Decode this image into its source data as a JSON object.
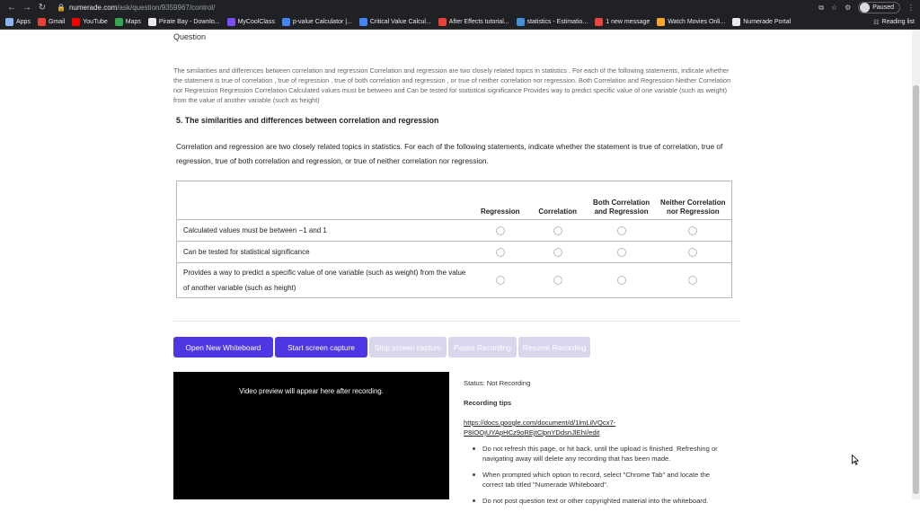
{
  "browser": {
    "url_host": "numerade.com",
    "url_path": "/ask/question/9359967/control/",
    "profile_label": "Paused",
    "bookmarks": [
      {
        "label": "Apps",
        "color": "#8ab4f8"
      },
      {
        "label": "Gmail",
        "color": "#ea4335"
      },
      {
        "label": "YouTube",
        "color": "#ff0000"
      },
      {
        "label": "Maps",
        "color": "#34a853"
      },
      {
        "label": "Pirate Bay - Downlo...",
        "color": "#e8eaed"
      },
      {
        "label": "MyCoolClass",
        "color": "#7c4dff"
      },
      {
        "label": "p-value Calculator |...",
        "color": "#4285f4"
      },
      {
        "label": "Critical Value Calcul...",
        "color": "#4285f4"
      },
      {
        "label": "After Effects tutorial...",
        "color": "#ea4335"
      },
      {
        "label": "statistics - Estimatio...",
        "color": "#4a90d9"
      },
      {
        "label": "1 new message",
        "color": "#e8453c"
      },
      {
        "label": "Watch Movies Onli...",
        "color": "#f9a825"
      },
      {
        "label": "Numerade Portal",
        "color": "#e8eaed"
      }
    ],
    "reading_list": "Reading list"
  },
  "question": {
    "label": "Question",
    "text": "The similarities and differences between correlation and regression Correlation and regression are two closely related topics in statistics . For each of the following statements, indicate whether the statement is true of correlation , true of regression , true of both correlation and regression , or true of neither correlation nor regression. Both Correlation and Regression Neither Correlation nor Regression Regression Correlation Calculated values must be between and Can be tested for statistical significance Provides way to predict specific value of one variable (such as weight) from the value of another variable (such as height)"
  },
  "card": {
    "title": "5. The similarities and differences between correlation and regression",
    "description": "Correlation and regression are two closely related topics in statistics. For each of the following statements, indicate whether the statement is true of correlation, true of regression, true of both correlation and regression, or true of neither correlation nor regression.",
    "columns": [
      "Regression",
      "Correlation",
      "Both Correlation and Regression",
      "Neither Correlation nor Regression"
    ],
    "rows": [
      {
        "label": "Calculated values must be between −1 and 1"
      },
      {
        "label": "Can be tested for statistical significance"
      },
      {
        "label": "Provides a way to predict a specific value of one variable (such as weight) from the value of another variable (such as height)"
      }
    ]
  },
  "buttons": {
    "open_whiteboard": "Open New Whiteboard",
    "start_capture": "Start screen capture",
    "stop_capture": "Stop screen capture",
    "pause": "Pause Recording",
    "resume": "Resume Recording"
  },
  "video": {
    "placeholder": "Video preview will appear here after recording."
  },
  "recording": {
    "status": "Status: Not Recording",
    "tips_heading": "Recording tips",
    "link": "https://docs.google.com/document/d/1lmLilVQcx7-P8IOOjUYApHCz9oREjtClpnYDdsnJlEhI/edit",
    "tips": [
      "Do not refresh this page, or hit back, until the upload is finished. Refreshing or navigating away will delete any recording that has been made.",
      "When prompted which option to record, select \"Chrome Tab\" and locate the correct tab titled \"Numerade Whiteboard\".",
      "Do not post question text or other copyrighted material into the whiteboard."
    ]
  }
}
